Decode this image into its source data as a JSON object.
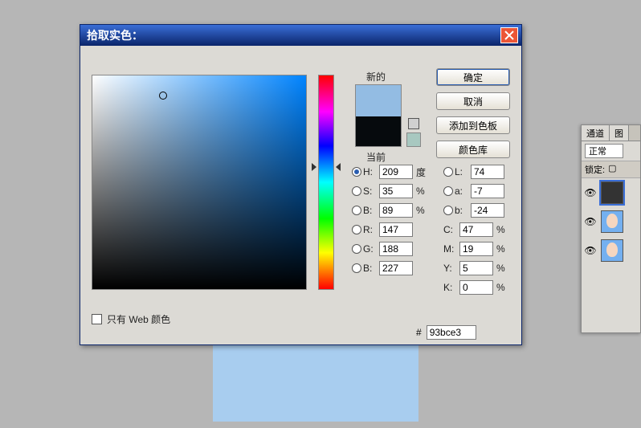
{
  "dialog": {
    "title": "拾取实色：",
    "new_label": "新的",
    "current_label": "当前",
    "web_only_label": "只有 Web 颜色",
    "hex": "93bce3",
    "hex_prefix": "#",
    "buttons": {
      "ok": "确定",
      "cancel": "取消",
      "add_swatch": "添加到色板",
      "libraries": "颜色库"
    },
    "hsb": {
      "h_label": "H:",
      "h": "209",
      "h_unit": "度",
      "s_label": "S:",
      "s": "35",
      "s_unit": "%",
      "b_label": "B:",
      "b": "89",
      "b_unit": "%"
    },
    "rgb": {
      "r_label": "R:",
      "r": "147",
      "g_label": "G:",
      "g": "188",
      "b_label": "B:",
      "b": "227"
    },
    "lab": {
      "l_label": "L:",
      "l": "74",
      "a_label": "a:",
      "a": "-7",
      "b_label": "b:",
      "b": "-24"
    },
    "cmyk": {
      "c_label": "C:",
      "c": "47",
      "unit": "%",
      "m_label": "M:",
      "m": "19",
      "y_label": "Y:",
      "y": "5",
      "k_label": "K:",
      "k": "0"
    }
  },
  "panel": {
    "tabs": {
      "channels": "通道",
      "layers": "图"
    },
    "blend_mode": "正常",
    "lock_label": "锁定:"
  }
}
